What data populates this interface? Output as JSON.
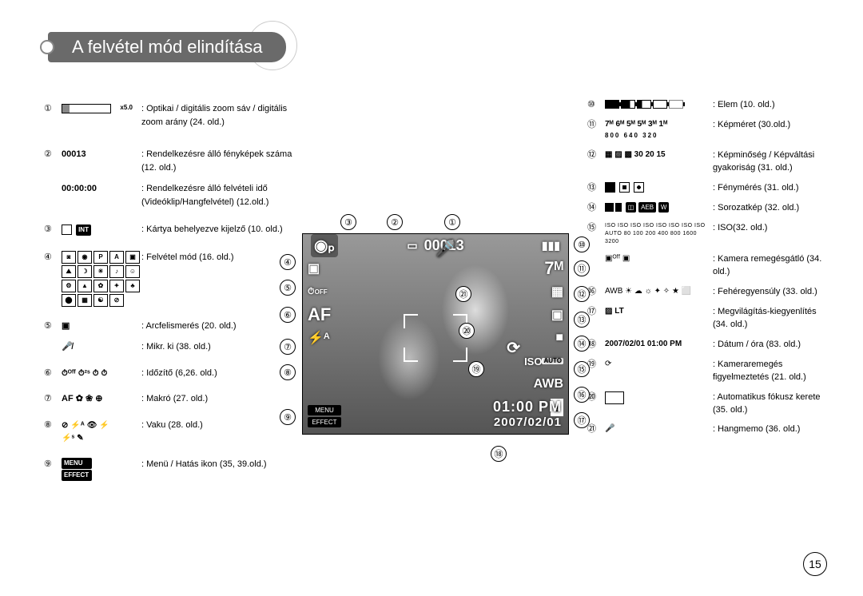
{
  "title": "A felvétel mód elindítása",
  "page_number": "15",
  "left": [
    {
      "n": "①",
      "icon": "zoom-bar",
      "desc": ": Optikai / digitális zoom sáv / digitális zoom arány (24. old.)"
    },
    {
      "n": "②",
      "icon_text": "00013",
      "desc": ": Rendelkezésre álló fényképek száma (12. old.)"
    },
    {
      "n": "",
      "icon_text": "00:00:00",
      "desc": ": Rendelkezésre álló felvételi idő (Videóklip/Hangfelvétel) (12.old.)"
    },
    {
      "n": "③",
      "icon": "card",
      "desc": ": Kártya behelyezve kijelző (10. old.)"
    },
    {
      "n": "④",
      "icon": "mode-grid",
      "desc": ": Felvétel mód (16. old.)"
    },
    {
      "n": "⑤",
      "icon": "face",
      "desc_a": ": Arcfelismerés (20. old.)",
      "icon2": "mic-off",
      "desc_b": ": Mikr. ki (38. old.)"
    },
    {
      "n": "⑥",
      "icon": "timers",
      "desc": ": Időzítő (6,26. old.)"
    },
    {
      "n": "⑦",
      "icon": "macro",
      "icon_text": "AF  ✿  ❀  ⊕",
      "desc": ": Makró (27. old.)"
    },
    {
      "n": "⑧",
      "icon": "flash",
      "desc": ": Vaku (28. old.)"
    },
    {
      "n": "⑨",
      "icon": "menu-effect",
      "desc": ": Menü / Hatás ikon (35, 39.old.)"
    }
  ],
  "right": [
    {
      "n": "⑩",
      "icon": "battery-levels",
      "desc": ": Elem (10. old.)"
    },
    {
      "n": "⑪",
      "icon": "size-list",
      "icon_text": "7ᴹ 6ᴹ 5ᴹ 5ᴹ 3ᴹ 1ᴹ",
      "sub": "800  640  320",
      "desc": ": Képméret (30.old.)"
    },
    {
      "n": "⑫",
      "icon": "quality",
      "icon_text": "▦ ▨ ▩  30 20 15",
      "desc": ": Képminőség / Képváltási gyakoriság (31. old.)"
    },
    {
      "n": "⑬",
      "icon": "metering",
      "desc": ": Fénymérés (31. old.)"
    },
    {
      "n": "⑭",
      "icon": "drive",
      "desc": ": Sorozatkép (32. old.)"
    },
    {
      "n": "⑮",
      "icon": "iso-list",
      "desc": ": ISO(32. old.)"
    },
    {
      "n": "",
      "icon": "ois",
      "desc": ": Kamera remegésgátló (34. old.)"
    },
    {
      "n": "⑯",
      "icon": "wb",
      "icon_text": "AWB ☀ ☁ ☼ ✦ ✧ ★ ⬜",
      "desc": ": Fehéregyensúly (33. old.)"
    },
    {
      "n": "⑰",
      "icon": "ev",
      "icon_text": "▨  LT",
      "desc": ": Megvilágítás-kiegyenlítés (34. old.)"
    },
    {
      "n": "⑱",
      "icon_text": "2007/02/01 01:00 PM",
      "desc": ": Dátum / óra (83. old.)"
    },
    {
      "n": "⑲",
      "icon": "shake",
      "icon_text": "⟳",
      "desc": ": Kameraremegés figyelmeztetés (21. old.)"
    },
    {
      "n": "⑳",
      "icon": "af-frame",
      "desc": ": Automatikus fókusz kerete (35. old.)"
    },
    {
      "n": "㉑",
      "icon": "voice",
      "icon_text": "🎤",
      "desc": ": Hangmemo (36. old.)"
    }
  ],
  "lcd": {
    "top_shots": "00013",
    "size": "7ᴹ",
    "quality": "▦",
    "metering": "▣",
    "drive": "■",
    "iso": "ISO AUTO",
    "wb": "AWB",
    "ev": "±",
    "date": "2007/02/01",
    "time": "01:00 PM",
    "af": "AF",
    "flash": "⚡ᴬ",
    "menu": "MENU",
    "effect": "EFFECT",
    "mode": "◉ₚ",
    "face": "▣",
    "timer": "⏱ off",
    "card": "▭"
  },
  "markers": {
    "top": [
      "③",
      "②",
      "①"
    ],
    "left": [
      "④",
      "⑤",
      "⑥",
      "⑦",
      "⑧",
      "⑨"
    ],
    "right": [
      "⑩",
      "⑪",
      "⑫",
      "⑬",
      "⑭",
      "⑮",
      "⑯",
      "⑰"
    ],
    "extra": {
      "18": "⑱",
      "19": "⑲",
      "20": "⑳",
      "21": "㉑"
    }
  }
}
